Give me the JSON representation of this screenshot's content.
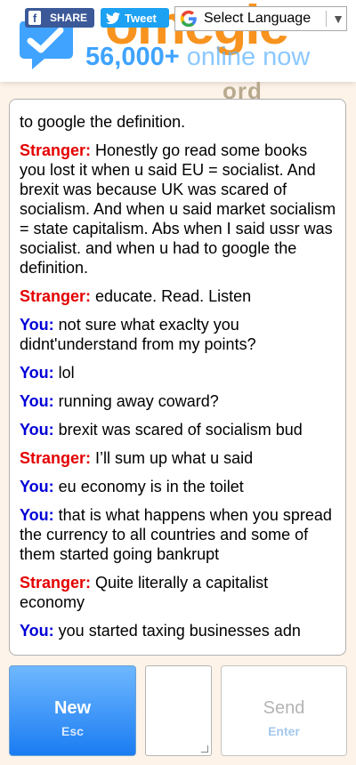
{
  "header": {
    "logo_text": "omegle",
    "online_count": "56,000+",
    "online_suffix": " online now",
    "facebook_share_label": "SHARE",
    "twitter_tweet_label": "Tweet",
    "language_select_label": "Select Language",
    "ghost_text": "ord"
  },
  "chat": {
    "messages": [
      {
        "speaker": "",
        "text": "to google the definition."
      },
      {
        "speaker": "Stranger:",
        "text": "Honestly go read some books you lost it when u said EU = socialist. And brexit was because UK was scared of socialism. And when u said market socialism = state capitalism. Abs when I said ussr was socialist. and when u had to google the definition."
      },
      {
        "speaker": "Stranger:",
        "text": "educate. Read. Listen"
      },
      {
        "speaker": "You:",
        "text": "not sure what exaclty you didnt'understand from my points?"
      },
      {
        "speaker": "You:",
        "text": "lol"
      },
      {
        "speaker": "You:",
        "text": "running away coward?"
      },
      {
        "speaker": "You:",
        "text": "brexit was scared of socialism bud"
      },
      {
        "speaker": "Stranger:",
        "text": "I’ll sum up what u said"
      },
      {
        "speaker": "You:",
        "text": "eu economy is in the toilet"
      },
      {
        "speaker": "You:",
        "text": "that is what happens when you spread the currency to all countries and some of them started going bankrupt"
      },
      {
        "speaker": "Stranger:",
        "text": "Quite literally a capitalist economy"
      },
      {
        "speaker": "You:",
        "text": "you started taxing businesses adn"
      }
    ]
  },
  "controls": {
    "new_label": "New",
    "new_shortcut": "Esc",
    "send_label": "Send",
    "send_shortcut": "Enter",
    "message_value": ""
  },
  "colors": {
    "stranger": "#e40000",
    "you": "#0000d8",
    "brand_orange": "#f7931e",
    "brand_blue": "#3fa3ff",
    "new_button": "#1a7cf2"
  },
  "icons": {
    "logo": "omegle-logo-icon",
    "facebook": "facebook-icon",
    "twitter": "twitter-bird-icon",
    "google": "google-g-icon",
    "dropdown": "dropdown-arrow-icon",
    "resize": "resize-grip-icon"
  }
}
